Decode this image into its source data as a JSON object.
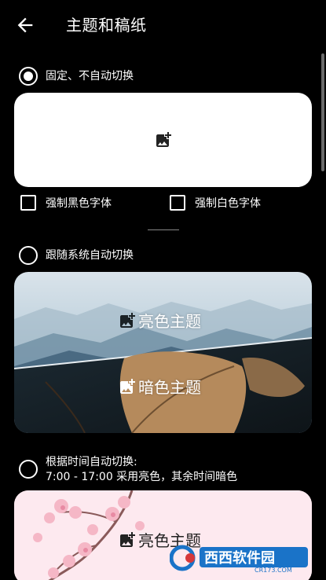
{
  "header": {
    "title": "主题和稿纸",
    "back_icon": "arrow-left-icon"
  },
  "options": [
    {
      "label": "固定、不自动切换",
      "checked": true
    },
    {
      "label": "跟随系统自动切换",
      "checked": false
    },
    {
      "label_line1": "根据时间自动切换:",
      "label_line2": "7:00 - 17:00 采用亮色，其余时间暗色",
      "checked": false
    }
  ],
  "fixed_card": {
    "icon": "add-image-icon"
  },
  "checkboxes": [
    {
      "label": "强制黑色字体",
      "checked": false
    },
    {
      "label": "强制白色字体",
      "checked": false
    }
  ],
  "follow_card": {
    "light_label": "亮色主题",
    "dark_label": "暗色主题"
  },
  "time_card": {
    "light_label": "亮色主题"
  },
  "watermark": {
    "text": "西西软件园",
    "sub": "CR173.COM"
  },
  "colors": {
    "background": "#000000",
    "accent": "#ffffff",
    "watermark_blue": "#1a73c8",
    "watermark_red": "#d6383a"
  }
}
